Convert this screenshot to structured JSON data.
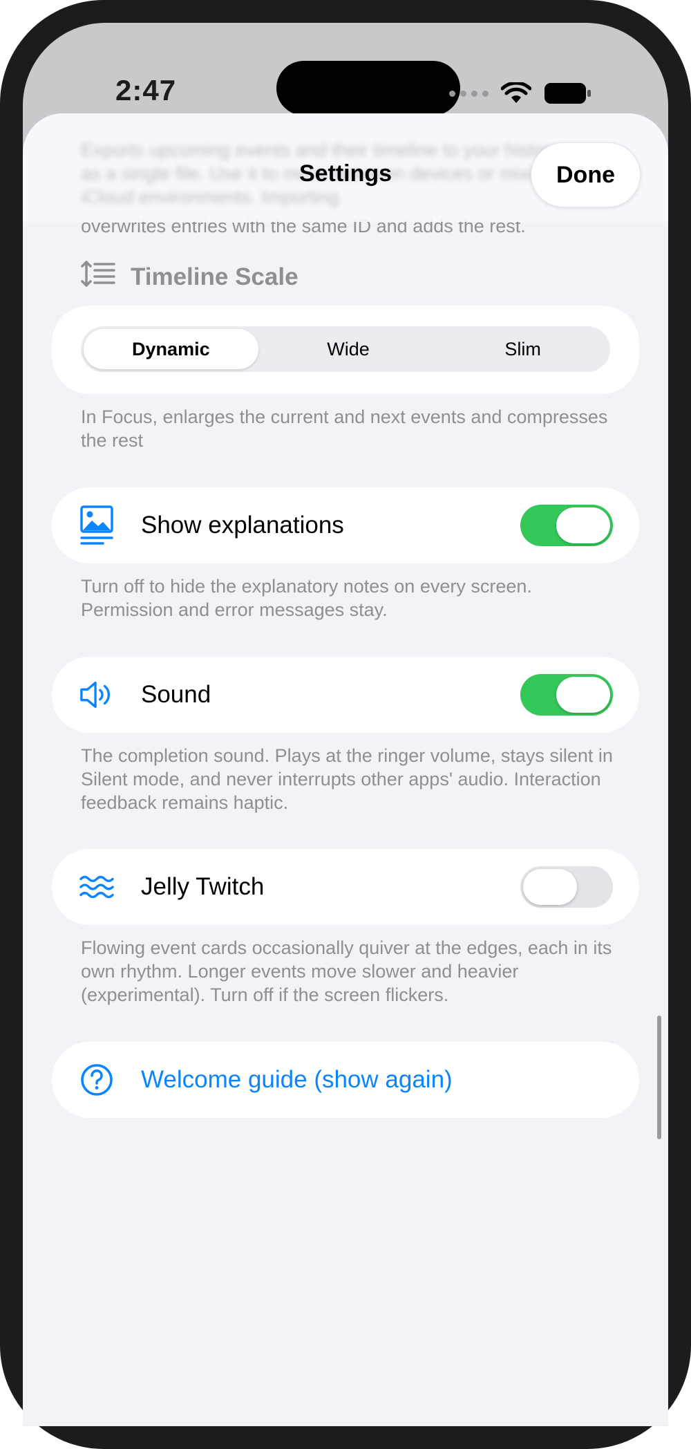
{
  "status_bar": {
    "time": "2:47",
    "icons": [
      "cellular-dots-icon",
      "wifi-icon",
      "battery-icon"
    ]
  },
  "sheet": {
    "title": "Settings",
    "done_label": "Done",
    "peek_text": "overwrites entries with the same ID and adds the rest.",
    "obscured_text": "Exports upcoming events and their timeline to your history as a single file. Use it to move between devices or mixing iCloud environments. Importing"
  },
  "timeline_scale": {
    "header": "Timeline Scale",
    "icon": "timeline-scale-icon",
    "options": [
      "Dynamic",
      "Wide",
      "Slim"
    ],
    "selected": "Dynamic",
    "footnote": "In Focus, enlarges the current and next events and compresses the rest"
  },
  "rows": {
    "explanations": {
      "label": "Show explanations",
      "icon": "image-text-icon",
      "enabled": true,
      "footnote": "Turn off to hide the explanatory notes on every screen. Permission and error messages stay."
    },
    "sound": {
      "label": "Sound",
      "icon": "speaker-wave-icon",
      "enabled": true,
      "footnote": "The completion sound. Plays at the ringer volume, stays silent in Silent mode, and never interrupts other apps' audio. Interaction feedback remains haptic."
    },
    "jelly": {
      "label": "Jelly Twitch",
      "icon": "waves-icon",
      "enabled": false,
      "footnote": "Flowing event cards occasionally quiver at the edges, each in its own rhythm. Longer events move slower and heavier (experimental). Turn off if the screen flickers."
    }
  },
  "welcome": {
    "label": "Welcome guide (show again)",
    "icon": "question-circle-icon"
  },
  "colors": {
    "accent": "#0a84ff",
    "toggle_on": "#34c759",
    "toggle_off": "#e3e3e8",
    "background": "#f2f2f7",
    "secondary_text": "#8e8e93"
  }
}
